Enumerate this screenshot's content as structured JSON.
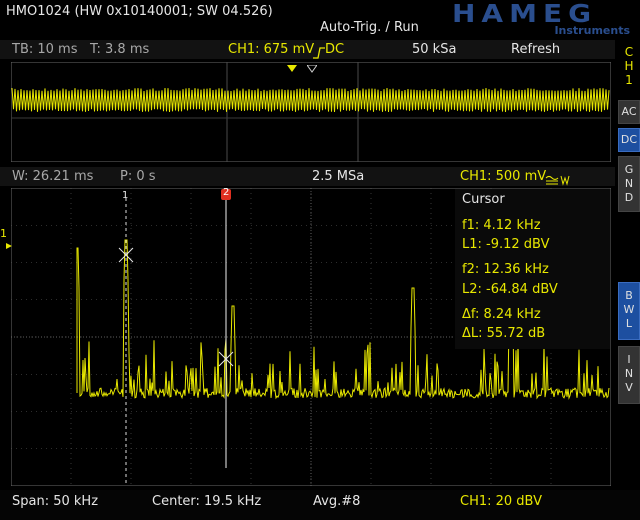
{
  "header": {
    "device": "HMO1024 (HW 0x10140001; SW 04.526)",
    "trigger": "Auto-Trig. / Run",
    "logo_main": "HAMEG",
    "logo_sub": "Instruments"
  },
  "time_info": {
    "tb": "TB: 10 ms",
    "t": "T: 3.8 ms",
    "ch1": "CH1: 675 mV",
    "coupling": "DC",
    "sample": "50 kSa",
    "mode": "Refresh"
  },
  "fft_info": {
    "w": "W: 26.21 ms",
    "p": "P: 0 s",
    "sample": "2.5 MSa",
    "ch1": "CH1: 500 mV"
  },
  "cursor_panel": {
    "title": "Cursor",
    "f1": "f1: 4.12 kHz",
    "l1": "L1: -9.12 dBV",
    "f2": "f2: 12.36 kHz",
    "l2": "L2: -64.84 dBV",
    "df": "Δf: 8.24 kHz",
    "dl": "ΔL: 55.72 dB"
  },
  "cursor_markers": {
    "c1": "1",
    "c2": "2"
  },
  "channel_marker": "1",
  "footer": {
    "span": "Span: 50 kHz",
    "center": "Center: 19.5 kHz",
    "avg": "Avg.#8",
    "scale": "CH1: 20 dBV"
  },
  "sidebar": {
    "ch": [
      "C",
      "H",
      "1"
    ],
    "ac": "AC",
    "dc": "DC",
    "gnd": [
      "G",
      "N",
      "D"
    ],
    "bwl": [
      "B",
      "W",
      "L"
    ],
    "inv": [
      "I",
      "N",
      "V"
    ]
  },
  "colors": {
    "trace": "#e8e800",
    "grid": "#5a5a5a",
    "accent": "#1d4fa0",
    "cursor_marker": "#e03020"
  }
}
